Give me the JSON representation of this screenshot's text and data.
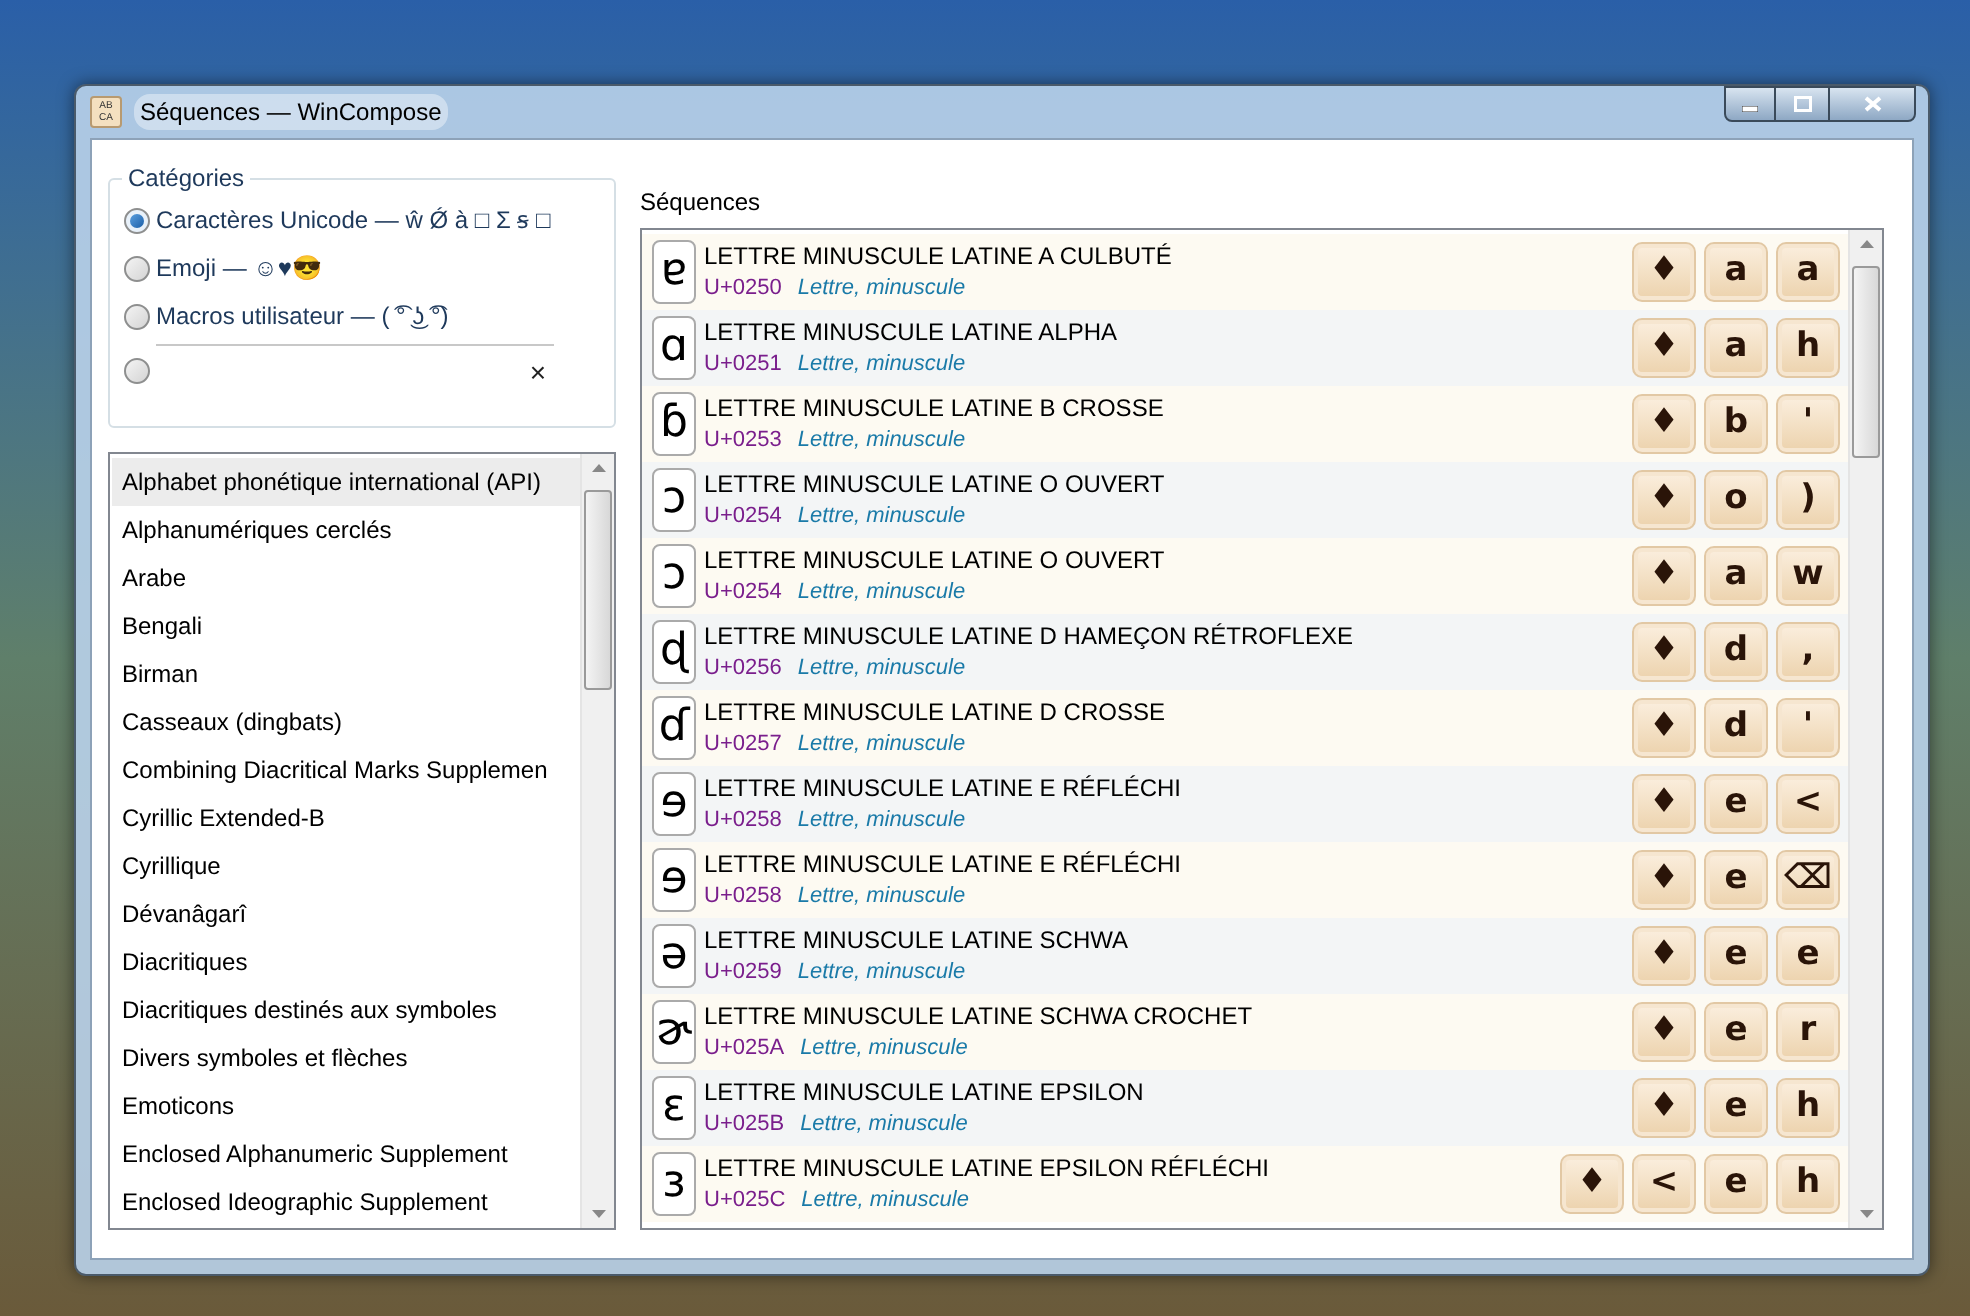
{
  "window": {
    "title": "Séquences — WinCompose",
    "icon_text": "AB CA"
  },
  "categories": {
    "title": "Catégories",
    "options": [
      {
        "kind": "radio",
        "label": "Caractères Unicode — ŵ Ǿ à □ Σ ꞩ □",
        "selected": true
      },
      {
        "kind": "radio",
        "label": "Emoji — ☺♥😎",
        "selected": false
      },
      {
        "kind": "radio",
        "label": "Macros utilisateur — ( ͡° ͜ʖ ͡°)",
        "selected": false
      },
      {
        "kind": "search",
        "clear": "×",
        "selected": false
      }
    ]
  },
  "blocks": [
    {
      "label": "Alphabet phonétique international (API)",
      "selected": true
    },
    {
      "label": "Alphanumériques cerclés",
      "selected": false
    },
    {
      "label": "Arabe",
      "selected": false
    },
    {
      "label": "Bengali",
      "selected": false
    },
    {
      "label": "Birman",
      "selected": false
    },
    {
      "label": "Casseaux (dingbats)",
      "selected": false
    },
    {
      "label": "Combining Diacritical Marks Supplemen",
      "selected": false
    },
    {
      "label": "Cyrillic Extended-B",
      "selected": false
    },
    {
      "label": "Cyrillique",
      "selected": false
    },
    {
      "label": "Dévanâgarî",
      "selected": false
    },
    {
      "label": "Diacritiques",
      "selected": false
    },
    {
      "label": "Diacritiques destinés aux symboles",
      "selected": false
    },
    {
      "label": "Divers symboles et flèches",
      "selected": false
    },
    {
      "label": "Emoticons",
      "selected": false
    },
    {
      "label": "Enclosed Alphanumeric Supplement",
      "selected": false
    },
    {
      "label": "Enclosed Ideographic Supplement",
      "selected": false
    }
  ],
  "sequences_title": "Séquences",
  "sequences": [
    {
      "glyph": "ɐ",
      "name": "LETTRE MINUSCULE LATINE A CULBUTÉ",
      "code": "U+0250",
      "category": "Lettre, minuscule",
      "keys": [
        "♦",
        "a",
        "a"
      ]
    },
    {
      "glyph": "ɑ",
      "name": "LETTRE MINUSCULE LATINE ALPHA",
      "code": "U+0251",
      "category": "Lettre, minuscule",
      "keys": [
        "♦",
        "a",
        "h"
      ]
    },
    {
      "glyph": "ɓ",
      "name": "LETTRE MINUSCULE LATINE B CROSSE",
      "code": "U+0253",
      "category": "Lettre, minuscule",
      "keys": [
        "♦",
        "b",
        "'"
      ]
    },
    {
      "glyph": "ɔ",
      "name": "LETTRE MINUSCULE LATINE O OUVERT",
      "code": "U+0254",
      "category": "Lettre, minuscule",
      "keys": [
        "♦",
        "o",
        ")"
      ]
    },
    {
      "glyph": "ɔ",
      "name": "LETTRE MINUSCULE LATINE O OUVERT",
      "code": "U+0254",
      "category": "Lettre, minuscule",
      "keys": [
        "♦",
        "a",
        "w"
      ]
    },
    {
      "glyph": "ɖ",
      "name": "LETTRE MINUSCULE LATINE D HAMEÇON RÉTROFLEXE",
      "code": "U+0256",
      "category": "Lettre, minuscule",
      "keys": [
        "♦",
        "d",
        ","
      ]
    },
    {
      "glyph": "ɗ",
      "name": "LETTRE MINUSCULE LATINE D CROSSE",
      "code": "U+0257",
      "category": "Lettre, minuscule",
      "keys": [
        "♦",
        "d",
        "'"
      ]
    },
    {
      "glyph": "ɘ",
      "name": "LETTRE MINUSCULE LATINE E RÉFLÉCHI",
      "code": "U+0258",
      "category": "Lettre, minuscule",
      "keys": [
        "♦",
        "e",
        "<"
      ]
    },
    {
      "glyph": "ɘ",
      "name": "LETTRE MINUSCULE LATINE E RÉFLÉCHI",
      "code": "U+0258",
      "category": "Lettre, minuscule",
      "keys": [
        "♦",
        "e",
        "⌫"
      ]
    },
    {
      "glyph": "ə",
      "name": "LETTRE MINUSCULE LATINE SCHWA",
      "code": "U+0259",
      "category": "Lettre, minuscule",
      "keys": [
        "♦",
        "e",
        "e"
      ]
    },
    {
      "glyph": "ɚ",
      "name": "LETTRE MINUSCULE LATINE SCHWA CROCHET",
      "code": "U+025A",
      "category": "Lettre, minuscule",
      "keys": [
        "♦",
        "e",
        "r"
      ]
    },
    {
      "glyph": "ɛ",
      "name": "LETTRE MINUSCULE LATINE EPSILON",
      "code": "U+025B",
      "category": "Lettre, minuscule",
      "keys": [
        "♦",
        "e",
        "h"
      ]
    },
    {
      "glyph": "ɜ",
      "name": "LETTRE MINUSCULE LATINE EPSILON RÉFLÉCHI",
      "code": "U+025C",
      "category": "Lettre, minuscule",
      "keys": [
        "♦",
        "<",
        "e",
        "h"
      ]
    }
  ]
}
